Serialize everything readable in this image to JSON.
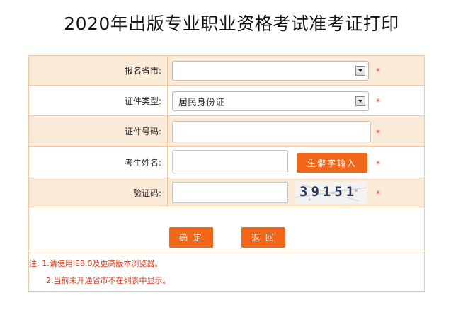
{
  "page": {
    "title": "2020年出版专业职业资格考试准考证打印"
  },
  "form": {
    "province": {
      "label": "报名省市:",
      "value": "",
      "required": "*"
    },
    "id_type": {
      "label": "证件类型:",
      "value": "居民身份证",
      "required": "*"
    },
    "id_number": {
      "label": "证件号码:",
      "value": "",
      "required": "*"
    },
    "name": {
      "label": "考生姓名:",
      "value": "",
      "rare_char_button": "生僻字输入",
      "required": "*"
    },
    "captcha": {
      "label": "验证码:",
      "value": "",
      "image_text": "39151",
      "required": "*"
    }
  },
  "buttons": {
    "confirm": "确 定",
    "back": "返 回"
  },
  "notes": {
    "line1": "注: 1.请使用IE8.0及更高版本浏览器。",
    "line2": "2.当前未开通省市不在列表中显示。"
  },
  "colors": {
    "accent": "#f26619",
    "row_alt": "#fdebd9",
    "border": "#f0c8a4",
    "required": "#e23b1a"
  }
}
